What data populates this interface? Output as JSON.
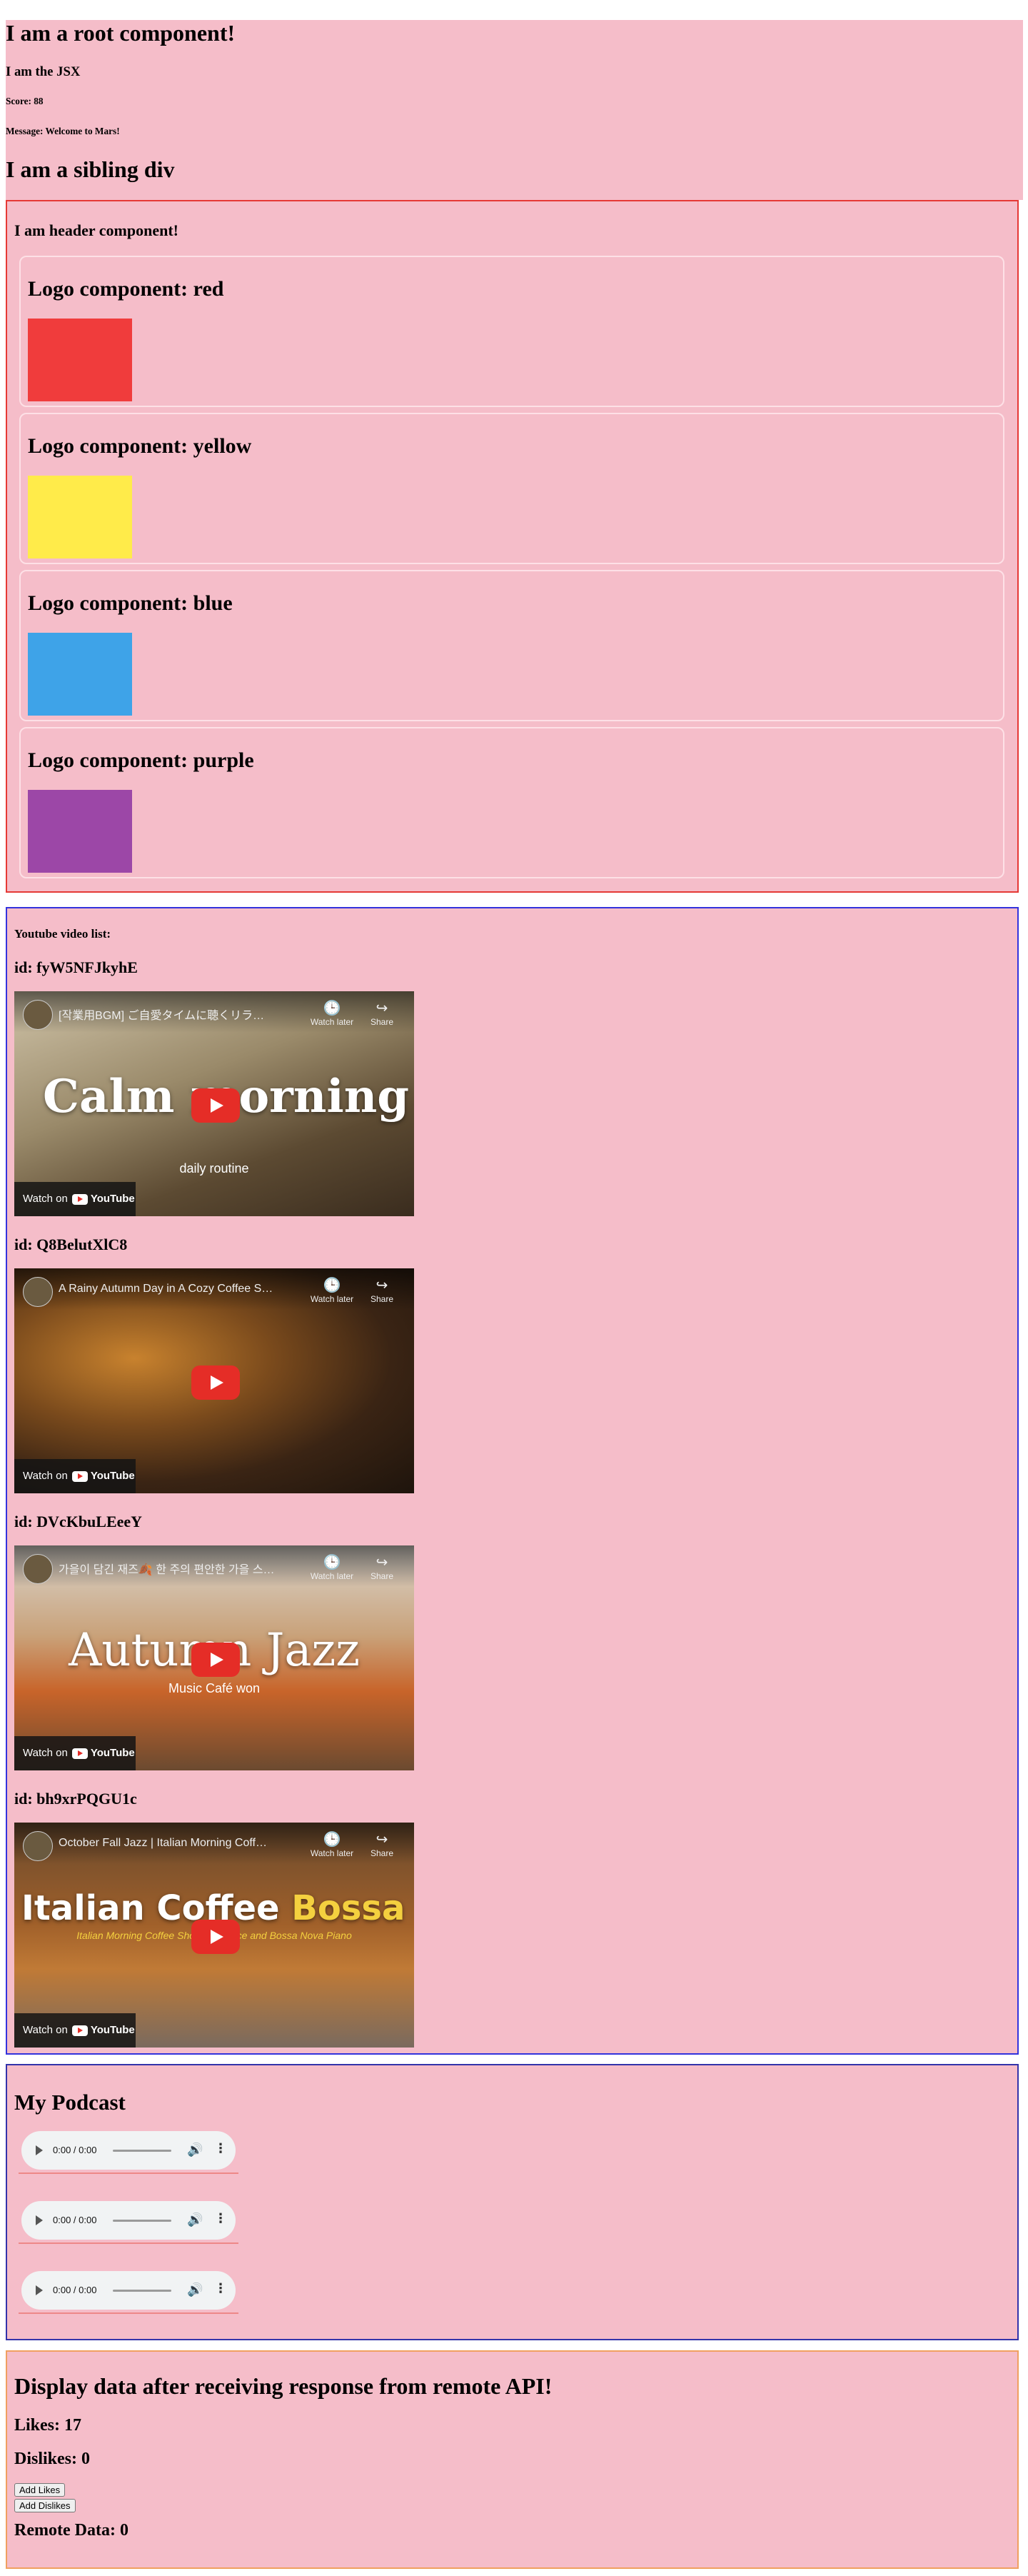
{
  "root": {
    "title": "I am a root component!",
    "jsx": "I am the JSX",
    "score": "Score: 88",
    "message": "Message: Welcome to Mars!",
    "sibling": "I am a sibling div"
  },
  "header": {
    "title": "I am header component!",
    "logos": [
      {
        "label": "Logo component: red",
        "color": "#f03c3c"
      },
      {
        "label": "Logo component: yellow",
        "color": "#ffeb4a"
      },
      {
        "label": "Logo component: blue",
        "color": "#3ea3e8"
      },
      {
        "label": "Logo component: purple",
        "color": "#9c47a7"
      }
    ]
  },
  "youtube": {
    "label": "Youtube video list:",
    "watch_on": "Watch on",
    "youtube_text": "YouTube",
    "watch_later": "Watch later",
    "share": "Share",
    "videos": [
      {
        "id": "id: fyW5NFJkyhE",
        "title": "[작業用BGM] ご自愛タイムに聴くリラ…",
        "big": "Calm morning",
        "sub": "daily routine"
      },
      {
        "id": "id: Q8BelutXlC8",
        "title": "A Rainy Autumn Day in A Cozy Coffee S…",
        "big": "",
        "sub": ""
      },
      {
        "id": "id: DVcKbuLEeeY",
        "title": "가을이 담긴 재즈🍂 한 주의 편안한 가을 스…",
        "big": "Autumn Jazz",
        "sub": "Music Café won"
      },
      {
        "id": "id: bh9xrPQGU1c",
        "title": "October Fall Jazz | Italian Morning Coff…",
        "big": "Italian Coffee",
        "big2": "Bossa Nova",
        "sub": "Italian Morning Coffee Shop Ambience and Bossa Nova Piano"
      }
    ]
  },
  "podcast": {
    "title": "My Podcast",
    "players": [
      {
        "time": "0:00 / 0:00"
      },
      {
        "time": "0:00 / 0:00"
      },
      {
        "time": "0:00 / 0:00"
      }
    ]
  },
  "api": {
    "title": "Display data after receiving response from remote API!",
    "likes": "Likes: 17",
    "dislikes": "Dislikes: 0",
    "add_likes": "Add Likes",
    "add_dislikes": "Add Dislikes",
    "remote": "Remote Data: 0"
  }
}
